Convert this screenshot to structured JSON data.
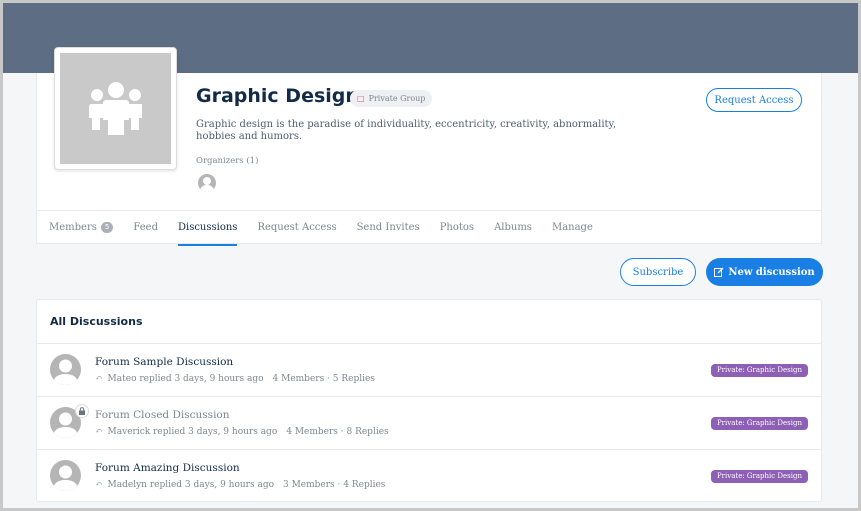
{
  "group": {
    "title": "Graphic Design",
    "privacy": "Private Group",
    "description": "Graphic design is the paradise of individuality, eccentricity, creativity, abnormality, hobbies and humors.",
    "organizers_label": "Organizers (1)",
    "request_access_label": "Request Access"
  },
  "tabs": [
    {
      "label": "Members",
      "count": "5"
    },
    {
      "label": "Feed"
    },
    {
      "label": "Discussions"
    },
    {
      "label": "Request Access"
    },
    {
      "label": "Send Invites"
    },
    {
      "label": "Photos"
    },
    {
      "label": "Albums"
    },
    {
      "label": "Manage"
    }
  ],
  "actions": {
    "subscribe_label": "Subscribe",
    "new_discussion_label": "New discussion"
  },
  "discussions": {
    "title": "All Discussions",
    "items": [
      {
        "title": "Forum Sample Discussion",
        "reply": "Mateo replied 3 days, 9 hours ago",
        "members": "4 Members · 5 Replies",
        "tag": "Private: Graphic Design"
      },
      {
        "title": "Forum Closed Discussion",
        "reply": "Maverick replied 3 days, 9 hours ago",
        "members": "4 Members · 8 Replies",
        "tag": "Private: Graphic Design"
      },
      {
        "title": "Forum Amazing Discussion",
        "reply": "Madelyn replied 3 days, 9 hours ago",
        "members": "3 Members · 4 Replies",
        "tag": "Private: Graphic Design"
      }
    ]
  },
  "colors": {
    "cover": "#5d6e84",
    "accent": "#1a7fe4",
    "tag": "#8d5fb5"
  }
}
